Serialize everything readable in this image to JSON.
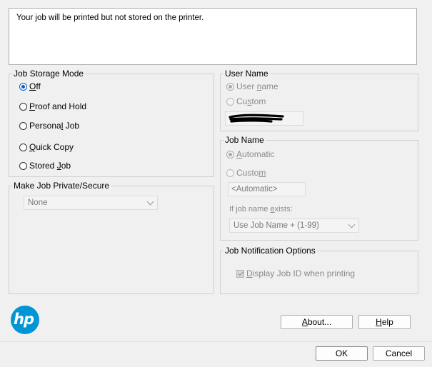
{
  "description": "Your job will be printed but not stored on the printer.",
  "job_storage": {
    "legend": "Job Storage Mode",
    "options": [
      {
        "prefix": "",
        "key": "O",
        "rest": "ff",
        "checked": true
      },
      {
        "prefix": "",
        "key": "P",
        "rest": "roof and Hold",
        "checked": false
      },
      {
        "prefix": "Persona",
        "key": "l",
        "rest": " Job",
        "checked": false
      },
      {
        "prefix": "",
        "key": "Q",
        "rest": "uick Copy",
        "checked": false
      },
      {
        "prefix": "Stored ",
        "key": "J",
        "rest": "ob",
        "checked": false
      }
    ]
  },
  "private": {
    "legend": "Make Job Private/Secure",
    "selected": "None"
  },
  "user_name": {
    "legend": "User Name",
    "option_user": {
      "prefix": "User ",
      "key": "n",
      "rest": "ame"
    },
    "option_custom": {
      "prefix": "Cu",
      "key": "s",
      "rest": "tom"
    }
  },
  "job_name": {
    "legend": "Job Name",
    "option_auto": {
      "prefix": "",
      "key": "A",
      "rest": "utomatic"
    },
    "option_custom": {
      "prefix": "Custo",
      "key": "m",
      "rest": ""
    },
    "name_value": "<Automatic>",
    "exists_label": {
      "prefix": "If job name ",
      "key": "e",
      "rest": "xists:"
    },
    "exists_selected": "Use Job Name + (1-99)"
  },
  "notification": {
    "legend": "Job Notification Options",
    "display": {
      "prefix": "",
      "key": "D",
      "rest": "isplay Job ID when printing"
    }
  },
  "buttons": {
    "about": {
      "prefix": "",
      "key": "A",
      "rest": "bout..."
    },
    "help": {
      "prefix": "",
      "key": "H",
      "rest": "elp"
    },
    "ok": "OK",
    "cancel": "Cancel"
  },
  "logo_text": "hp",
  "colors": {
    "hp_blue": "#0096d6",
    "accent": "#0a5cc2"
  }
}
